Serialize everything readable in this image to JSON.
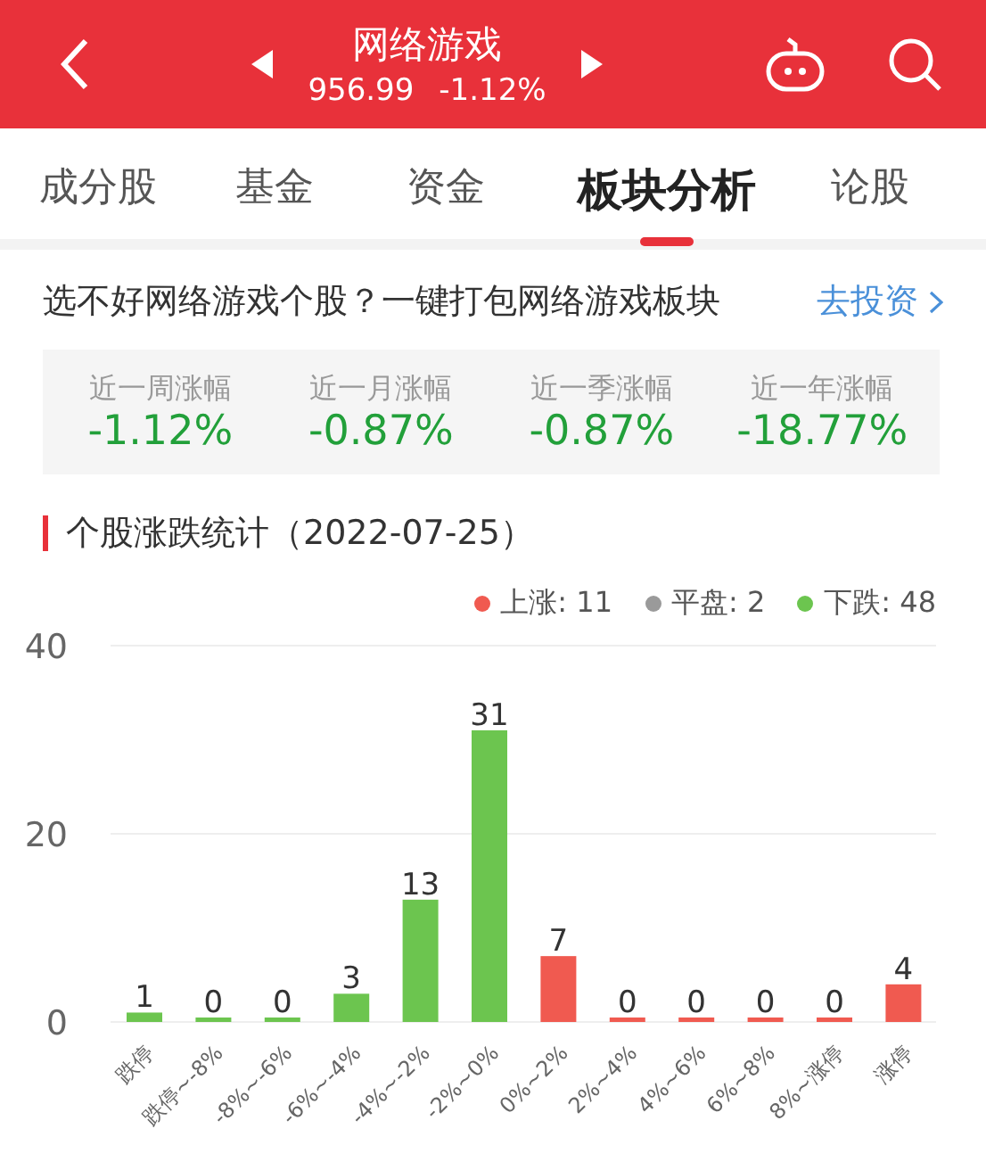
{
  "header": {
    "title": "网络游戏",
    "price": "956.99",
    "change": "-1.12%"
  },
  "tabs": [
    {
      "label": "成分股",
      "selected": false
    },
    {
      "label": "基金",
      "selected": false
    },
    {
      "label": "资金",
      "selected": false
    },
    {
      "label": "板块分析",
      "selected": true
    },
    {
      "label": "论股",
      "selected": false
    }
  ],
  "promo": {
    "text": "选不好网络游戏个股？一键打包网络游戏板块",
    "link": "去投资"
  },
  "stats": [
    {
      "label": "近一周涨幅",
      "value": "-1.12%"
    },
    {
      "label": "近一月涨幅",
      "value": "-0.87%"
    },
    {
      "label": "近一季涨幅",
      "value": "-0.87%"
    },
    {
      "label": "近一年涨幅",
      "value": "-18.77%"
    }
  ],
  "section_title": "个股涨跌统计（2022-07-25）",
  "legend": [
    {
      "label": "上涨: 11",
      "color": "#f05a50"
    },
    {
      "label": "平盘: 2",
      "color": "#9a9a9a"
    },
    {
      "label": "下跌: 48",
      "color": "#6cc54f"
    }
  ],
  "chart_data": {
    "type": "bar",
    "stacked": true,
    "data_labels": true,
    "ylim": [
      0,
      40
    ],
    "yticks": [
      0,
      20,
      40
    ],
    "categories": [
      "跌停",
      "跌停~-8%",
      "-8%~-6%",
      "-6%~-4%",
      "-4%~-2%",
      "-2%~0%",
      "0%~2%",
      "2%~4%",
      "4%~6%",
      "6%~8%",
      "8%~涨停",
      "涨停"
    ],
    "series": [
      {
        "color": "#6cc54f",
        "values": [
          1,
          0,
          0,
          3,
          13,
          31,
          null,
          null,
          null,
          null,
          null,
          null
        ]
      },
      {
        "color": "#f05a50",
        "values": [
          null,
          null,
          null,
          null,
          null,
          null,
          7,
          0,
          0,
          0,
          0,
          4
        ]
      }
    ]
  }
}
